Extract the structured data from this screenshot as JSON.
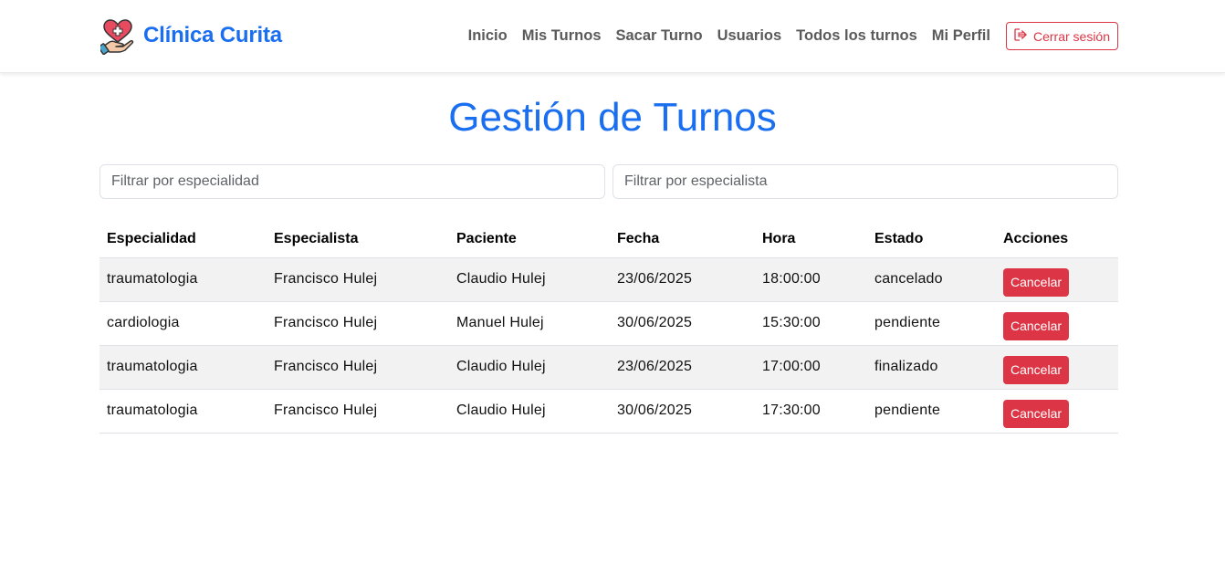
{
  "brand": {
    "name": "Clínica Curita",
    "icon": "heart-hand-logo-icon"
  },
  "nav": {
    "items": [
      "Inicio",
      "Mis Turnos",
      "Sacar Turno",
      "Usuarios",
      "Todos los turnos",
      "Mi Perfil"
    ],
    "logout_label": "Cerrar sesión"
  },
  "page": {
    "title": "Gestión de Turnos"
  },
  "filters": {
    "especialidad_placeholder": "Filtrar por especialidad",
    "especialista_placeholder": "Filtrar por especialista"
  },
  "table": {
    "headers": [
      "Especialidad",
      "Especialista",
      "Paciente",
      "Fecha",
      "Hora",
      "Estado",
      "Acciones"
    ],
    "rows": [
      {
        "especialidad": "traumatologia",
        "especialista": "Francisco Hulej",
        "paciente": "Claudio Hulej",
        "fecha": "23/06/2025",
        "hora": "18:00:00",
        "estado": "cancelado",
        "accion": "Cancelar"
      },
      {
        "especialidad": "cardiologia",
        "especialista": "Francisco Hulej",
        "paciente": "Manuel Hulej",
        "fecha": "30/06/2025",
        "hora": "15:30:00",
        "estado": "pendiente",
        "accion": "Cancelar"
      },
      {
        "especialidad": "traumatologia",
        "especialista": "Francisco Hulej",
        "paciente": "Claudio Hulej",
        "fecha": "23/06/2025",
        "hora": "17:00:00",
        "estado": "finalizado",
        "accion": "Cancelar"
      },
      {
        "especialidad": "traumatologia",
        "especialista": "Francisco Hulej",
        "paciente": "Claudio Hulej",
        "fecha": "30/06/2025",
        "hora": "17:30:00",
        "estado": "pendiente",
        "accion": "Cancelar"
      }
    ]
  },
  "colors": {
    "primary": "#1a6ef0",
    "danger": "#dc3545",
    "warning": "#f5b800",
    "nav_text": "#5a5a5a"
  }
}
